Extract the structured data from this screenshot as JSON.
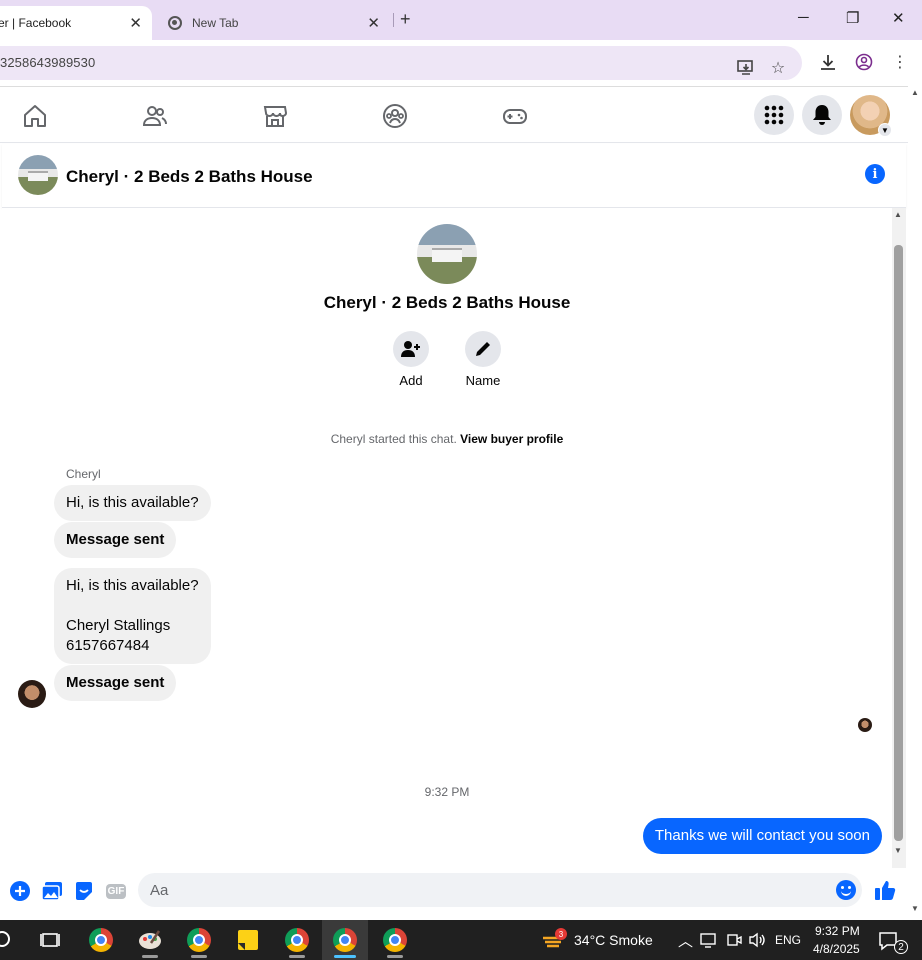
{
  "browser": {
    "active_tab_title": "er | Facebook",
    "inactive_tab_title": "New Tab",
    "url": "3258643989530"
  },
  "chat": {
    "header_title": "Cheryl · 2 Beds 2 Baths House",
    "convo_title": "Cheryl · 2 Beds 2 Baths House",
    "add_label": "Add",
    "name_label": "Name",
    "started_text": "Cheryl started this chat.",
    "buyer_profile_link": "View buyer profile",
    "sender_name": "Cheryl",
    "messages": [
      {
        "text": "Hi, is this available?"
      },
      {
        "text": "Message sent"
      },
      {
        "line1": "Hi, is this available?",
        "line2": "Cheryl Stallings",
        "line3": "6157667484"
      },
      {
        "text": "Message sent"
      }
    ],
    "timestamp": "9:32 PM",
    "outgoing_message": "Thanks we will contact you soon",
    "input_placeholder": "Aa",
    "gif_label": "GIF"
  },
  "taskbar": {
    "weather_badge": "3",
    "weather": "34°C  Smoke",
    "language": "ENG",
    "time": "9:32 PM",
    "date": "4/8/2025",
    "notification_count": "2"
  },
  "colors": {
    "accent": "#0866ff",
    "tab_strip": "#e8dcf4",
    "bubble_in": "#f0f0f0"
  }
}
